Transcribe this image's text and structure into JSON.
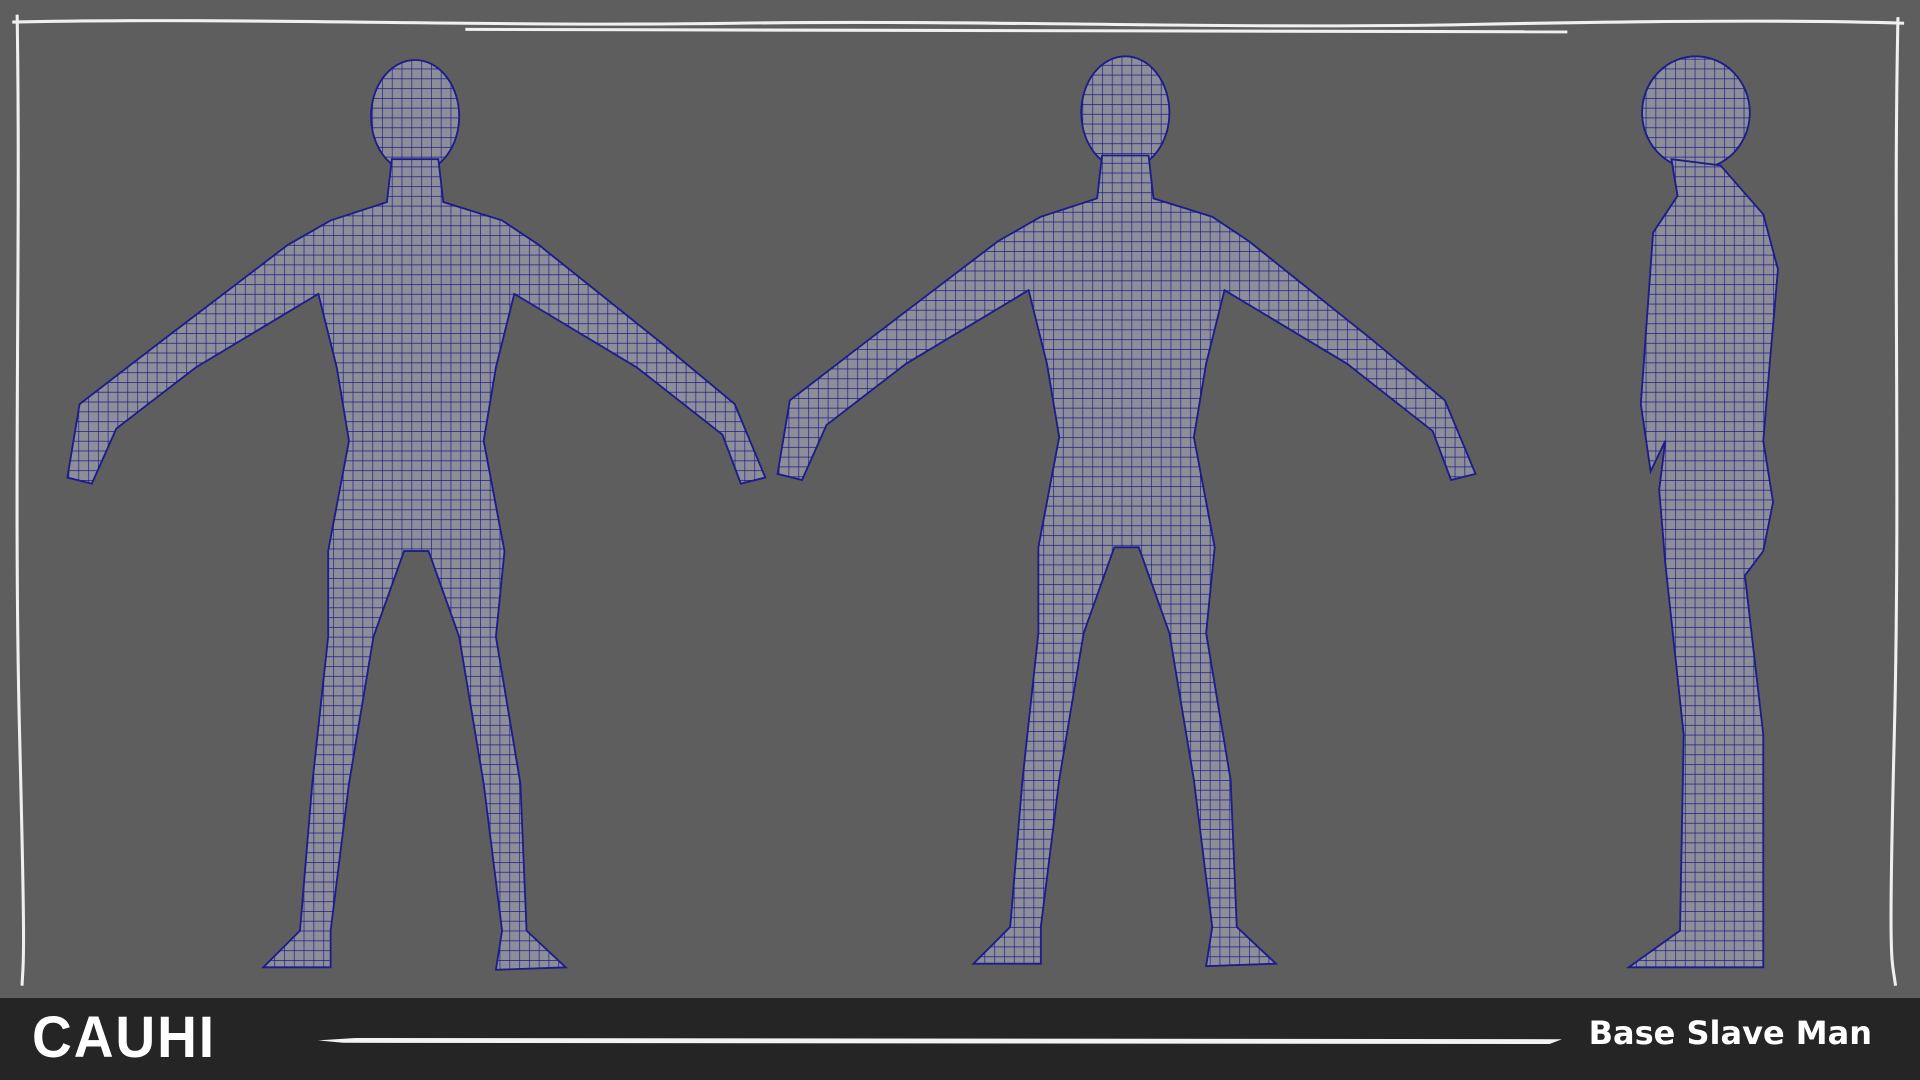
{
  "footer": {
    "logo": "CAUHI",
    "title": "Base Slave Man"
  },
  "colors": {
    "background": "#5e5e5e",
    "footer": "#252525",
    "wire": "#1c1c8c",
    "mesh": "#8e8e98"
  }
}
